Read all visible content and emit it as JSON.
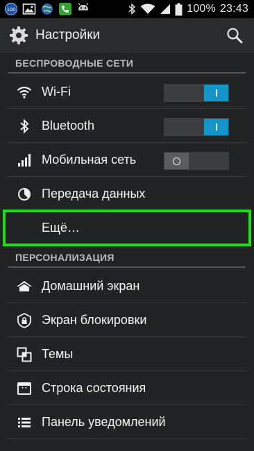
{
  "status_bar": {
    "notification_badge": "100",
    "battery_percent": "100%",
    "time": "23:43",
    "icons": [
      "badge-icon",
      "image-icon",
      "globe-icon",
      "phone-icon",
      "android-icon",
      "bluetooth-icon",
      "wifi-icon",
      "signal-icon",
      "battery-icon"
    ]
  },
  "action_bar": {
    "title": "Настройки",
    "icons": [
      "settings-gear-icon",
      "search-icon"
    ]
  },
  "sections": {
    "wireless": {
      "header": "БЕСПРОВОДНЫЕ СЕТИ",
      "items": [
        {
          "label": "Wi-Fi",
          "icon": "wifi-icon",
          "toggle": "on"
        },
        {
          "label": "Bluetooth",
          "icon": "bluetooth-icon",
          "toggle": "on"
        },
        {
          "label": "Мобильная сеть",
          "icon": "signal-icon",
          "toggle": "off"
        },
        {
          "label": "Передача данных",
          "icon": "data-usage-icon"
        },
        {
          "label": "Ещё…"
        }
      ]
    },
    "personalization": {
      "header": "ПЕРСОНАЛИЗАЦИЯ",
      "items": [
        {
          "label": "Домашний экран",
          "icon": "home-icon"
        },
        {
          "label": "Экран блокировки",
          "icon": "lock-icon"
        },
        {
          "label": "Темы",
          "icon": "themes-icon"
        },
        {
          "label": "Строка состояния",
          "icon": "status-bar-icon"
        },
        {
          "label": "Панель уведомлений",
          "icon": "notification-panel-icon"
        }
      ]
    }
  },
  "colors": {
    "background": "#222325",
    "toggle_on": "#1696c8",
    "highlight": "#1ee01a"
  }
}
